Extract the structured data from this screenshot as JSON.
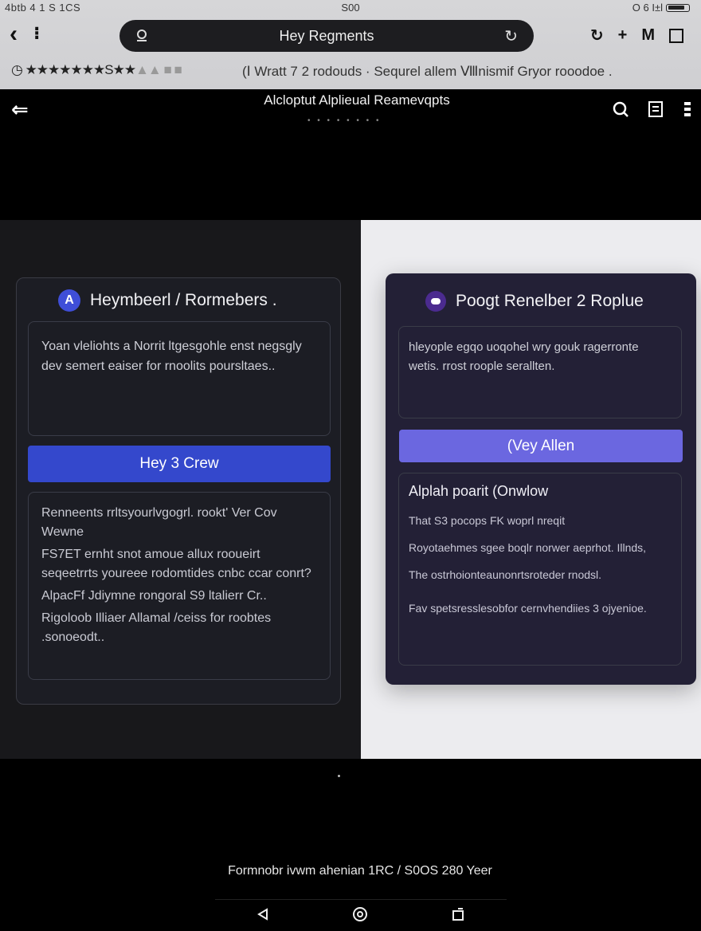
{
  "status_bar": {
    "left": "4btb 4 1 S 1CS",
    "center": "S00",
    "right": "O 6 I±l"
  },
  "browser": {
    "url_text": "Hey Regments",
    "right_label": "M",
    "rating_stars": "★★★★★★★",
    "rating_extra": "S★★",
    "rating_dim": "▲▲ ■ ■",
    "bookmark_text": "(Ⅰ Wratt 7 2 rodouds · Sequrel allem Ⅷnismif Gryor rooodoe ."
  },
  "app": {
    "title": "Alcloptut Alplieual Reamevqpts",
    "dots": "• • • • • • • •"
  },
  "left_card": {
    "badge": "A",
    "title": "Heymbeerl / Rormebers .",
    "intro": "Yoan vleliohts a Norrit ltgesgohle enst negsgly dev semert eaiser for rnoolits poursltaes..",
    "button": "Hey 3 Crew",
    "lines": [
      "Renneents rrltsyourlvgogrl. rookt' Ver Cov Wewne",
      "FS7ET ernht snot amoue allux rooueirt seqeetrrts youreee rodomtides cnbc ccar conrt?",
      "AlpacFf Jdiymne rongoral S9 ltalierr Cr..",
      "Rigoloob Illiaer Allamal /ceiss for roobtes .sonoeodt.."
    ]
  },
  "right_card": {
    "title": "Poogt Renelber 2 Roplue",
    "intro": "hleyople egqo uoqohel wry gouk ragerronte wetis. rrost roople serallten.",
    "button": "(Vey Allen",
    "section_title": "Alplah poarit (Onwlow",
    "lines": [
      "That S3 pocops FK woprl nreqit",
      "Royotaehmes sgee boqlr norwer aeprhot. Illnds,",
      "The ostrhoionteaunonrtsroteder rnodsl.",
      "Fav spetsresslesobfor cernvhendiies 3 ojyenioe."
    ]
  },
  "footer": {
    "text": "Formnobr ivwm ahenian 1RC / S0OS 280 Yeer"
  },
  "colors": {
    "accent_left": "#3448cc",
    "accent_right": "#6b67e0",
    "badge_purple": "#4b2b8f"
  }
}
